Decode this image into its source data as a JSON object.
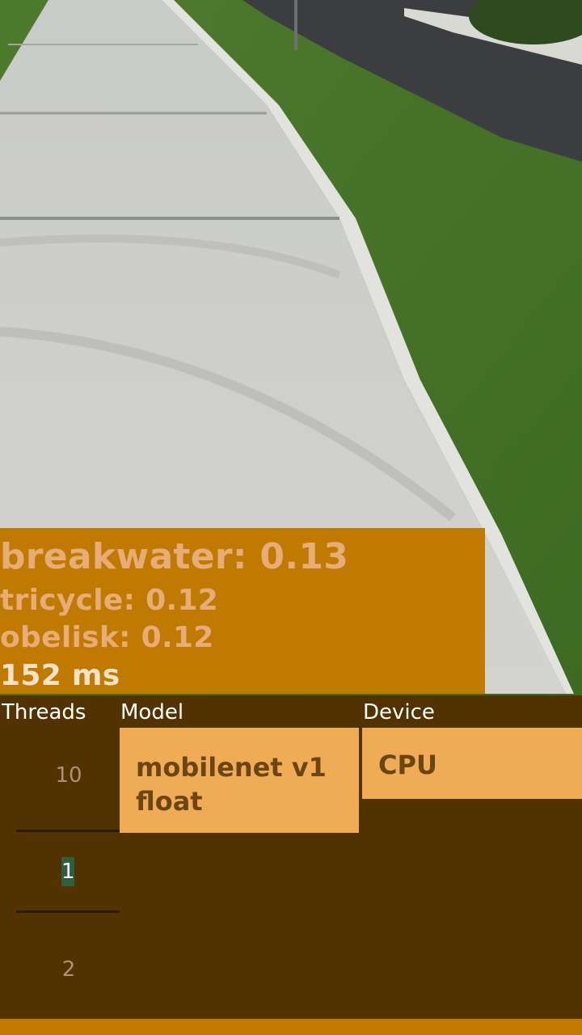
{
  "results": {
    "line1": "breakwater: 0.13",
    "line2": "tricycle: 0.12",
    "line3": "obelisk: 0.12",
    "latency": "152 ms"
  },
  "controls": {
    "threads_header": "Threads",
    "model_header": "Model",
    "device_header": "Device",
    "threads_options": [
      "10",
      "1",
      "2"
    ],
    "threads_selected": "1",
    "model_selected": "mobilenet v1 float",
    "device_selected": "CPU"
  },
  "colors": {
    "overlay": "#c17a00",
    "panel": "#523300",
    "spinner": "#efac55"
  }
}
